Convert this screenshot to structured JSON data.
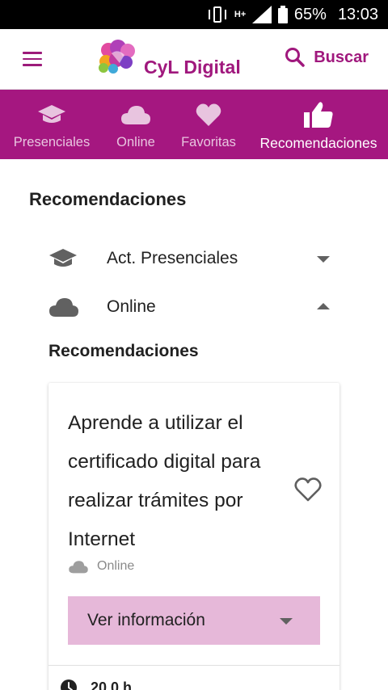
{
  "status_bar": {
    "battery": "65%",
    "time": "13:03",
    "network": "H+"
  },
  "app_bar": {
    "brand": "CyL Digital",
    "search_label": "Buscar"
  },
  "tabs": [
    {
      "label": "Presenciales",
      "icon": "graduation-cap-icon",
      "active": false
    },
    {
      "label": "Online",
      "icon": "cloud-icon",
      "active": false
    },
    {
      "label": "Favoritas",
      "icon": "heart-icon",
      "active": false
    },
    {
      "label": "Recomendaciones",
      "icon": "thumbs-up-icon",
      "active": true
    }
  ],
  "main": {
    "heading": "Recomendaciones",
    "sections": [
      {
        "label": "Act. Presenciales",
        "icon": "graduation-cap-icon",
        "expanded": false
      },
      {
        "label": "Online",
        "icon": "cloud-icon",
        "expanded": true
      }
    ],
    "subheading": "Recomendaciones",
    "card": {
      "title": "Aprende a utilizar el certificado digital para realizar trámites por Internet",
      "mode": "Online",
      "info_button": "Ver información",
      "duration": "20,0 h"
    }
  },
  "colors": {
    "brand": "#a51780",
    "info_button_bg": "#e6b8d9"
  }
}
